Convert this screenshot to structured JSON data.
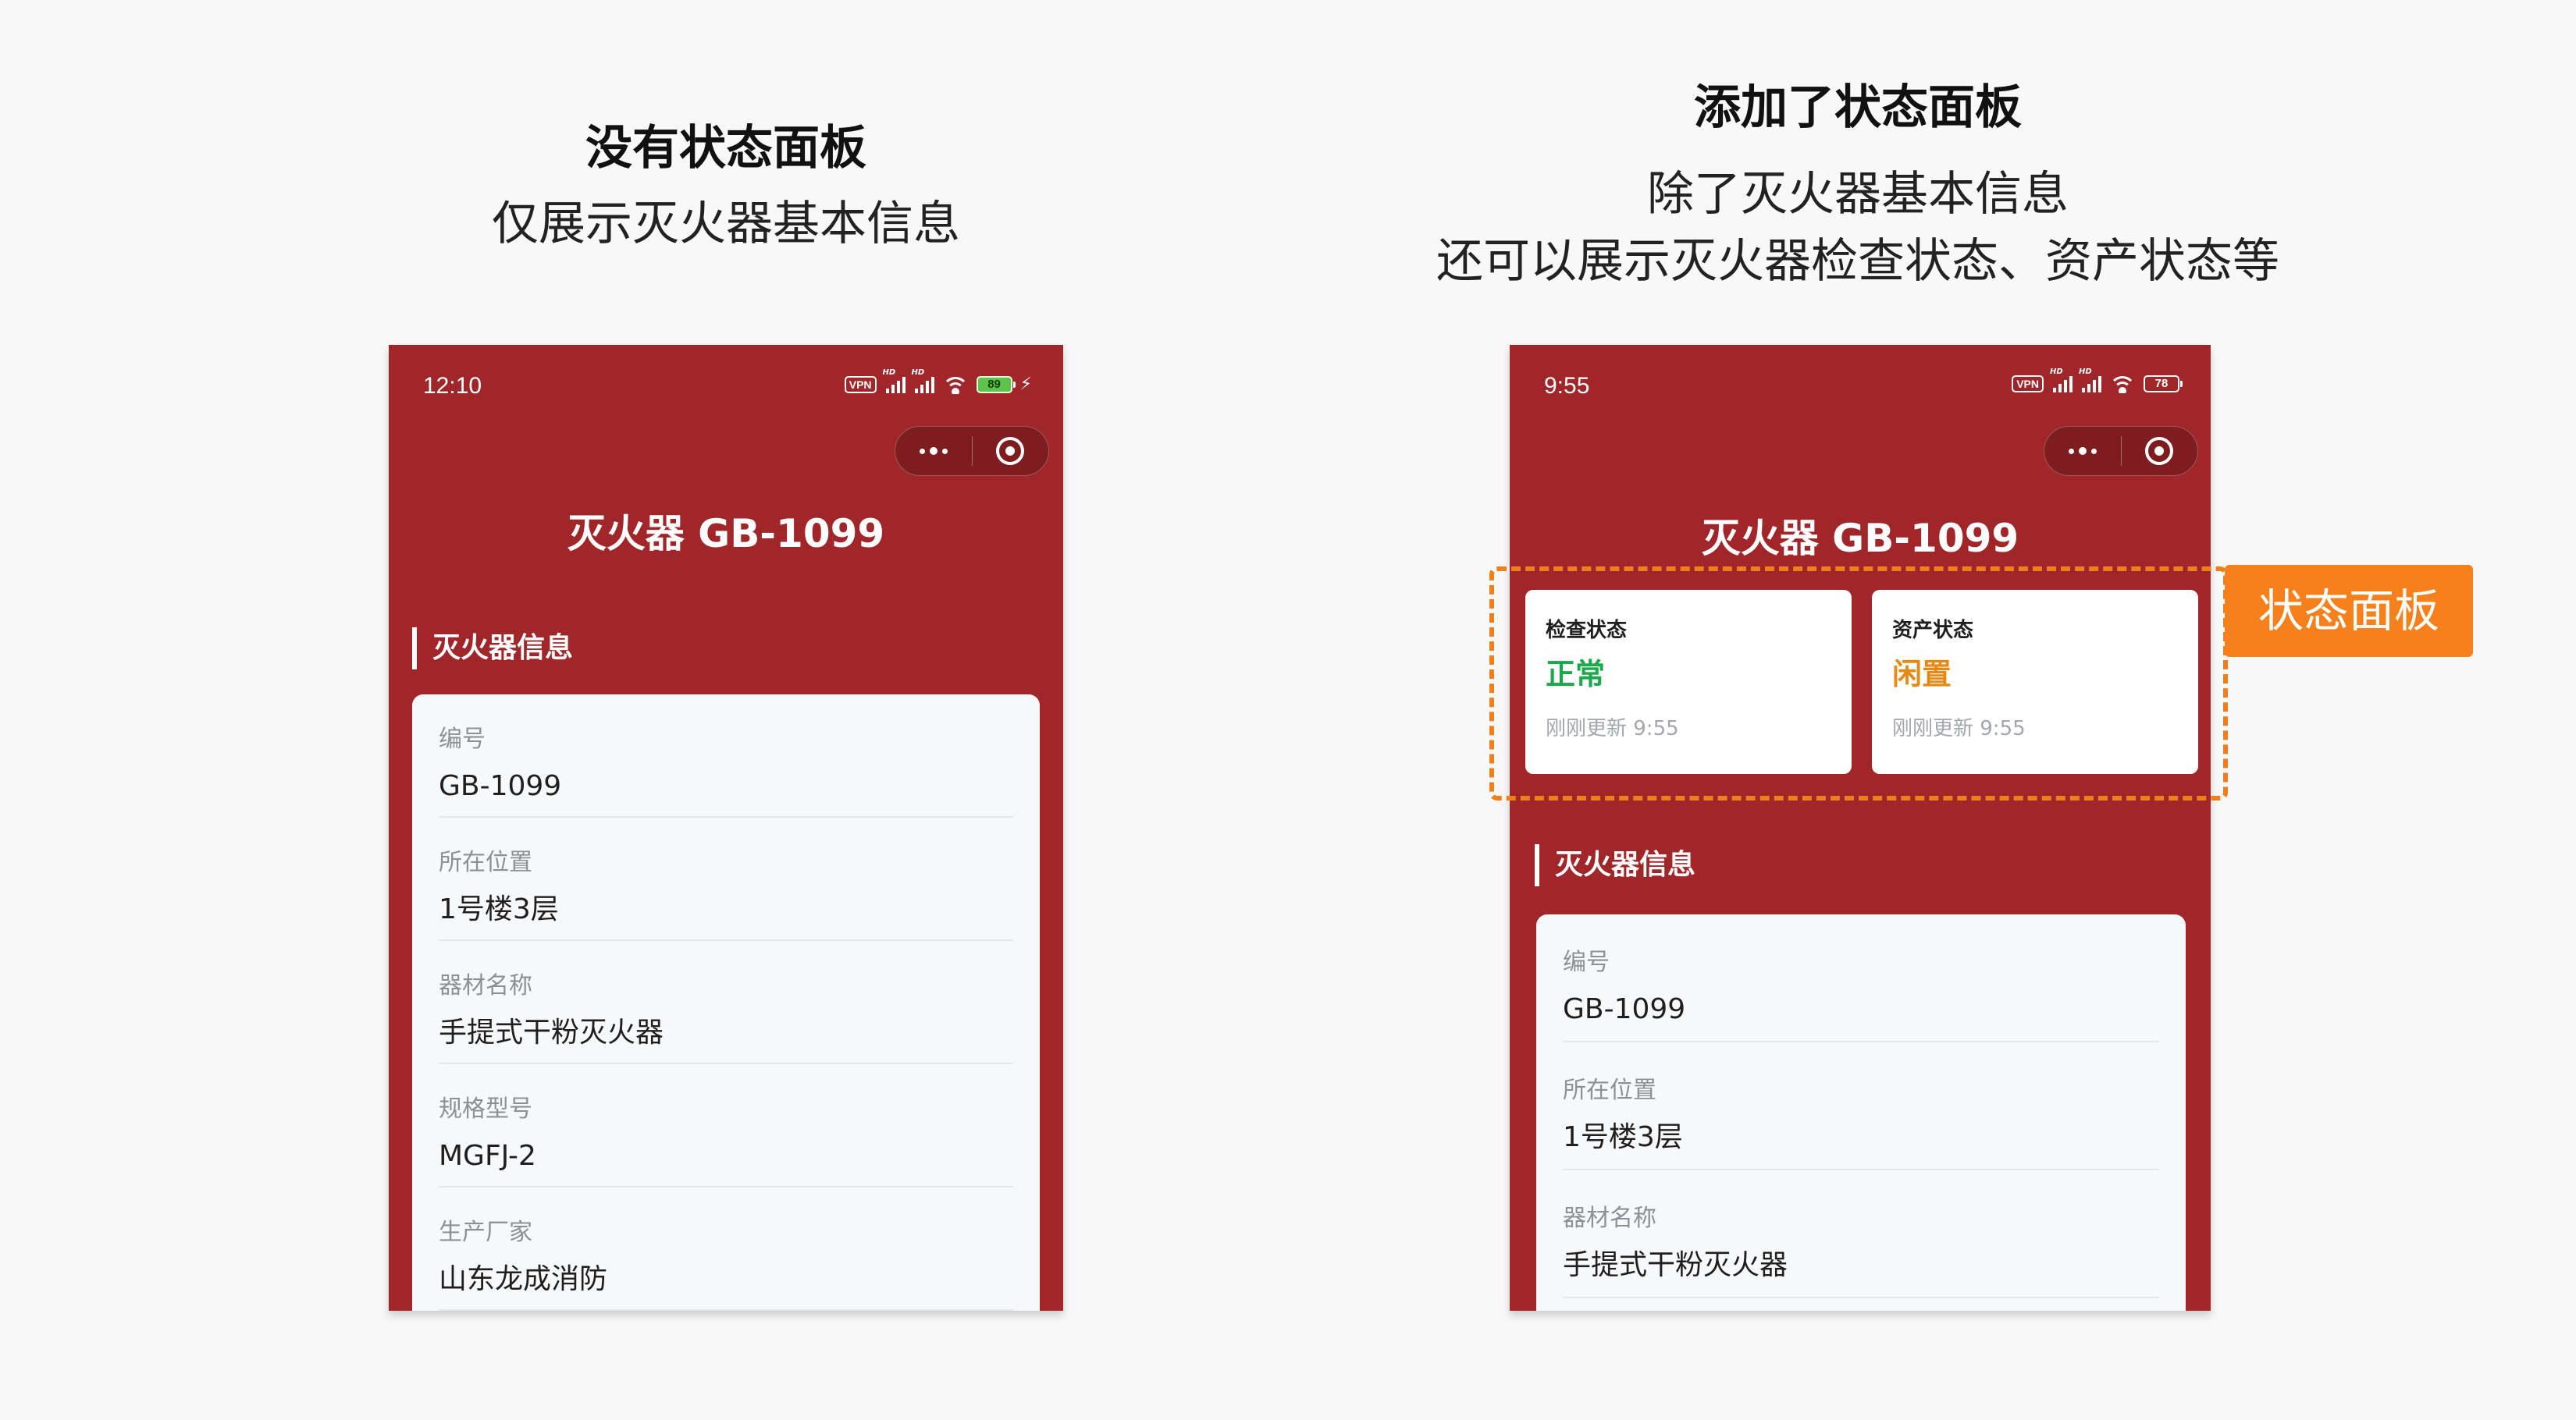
{
  "left_caption": {
    "title": "没有状态面板",
    "lines": [
      "仅展示灭火器基本信息"
    ]
  },
  "right_caption": {
    "title": "添加了状态面板",
    "lines": [
      "除了灭火器基本信息",
      "还可以展示灭火器检查状态、资产状态等"
    ]
  },
  "left_phone": {
    "status_bar": {
      "time": "12:10",
      "vpn": "VPN",
      "hd": "HD",
      "battery": "89",
      "battery_color": "#5ec34a"
    },
    "nav_title": "灭火器 GB-1099",
    "section_title": "灭火器信息",
    "info_rows": [
      {
        "label": "编号",
        "value": "GB-1099"
      },
      {
        "label": "所在位置",
        "value": "1号楼3层"
      },
      {
        "label": "器材名称",
        "value": "手提式干粉灭火器"
      },
      {
        "label": "规格型号",
        "value": "MGFJ-2"
      },
      {
        "label": "生产厂家",
        "value": "山东龙成消防"
      }
    ]
  },
  "right_phone": {
    "status_bar": {
      "time": "9:55",
      "vpn": "VPN",
      "hd": "HD",
      "battery": "78"
    },
    "nav_title": "灭火器 GB-1099",
    "status_cards": [
      {
        "label": "检查状态",
        "value": "正常",
        "value_color": "#1ba84a",
        "updated": "刚刚更新 9:55"
      },
      {
        "label": "资产状态",
        "value": "闲置",
        "value_color": "#e68a17",
        "updated": "刚刚更新 9:55"
      }
    ],
    "section_title": "灭火器信息",
    "info_rows": [
      {
        "label": "编号",
        "value": "GB-1099"
      },
      {
        "label": "所在位置",
        "value": "1号楼3层"
      },
      {
        "label": "器材名称",
        "value": "手提式干粉灭火器"
      }
    ]
  },
  "panel_tag": "状态面板",
  "colors": {
    "brand_red": "#a1262a",
    "highlight_orange": "#f5801c"
  }
}
